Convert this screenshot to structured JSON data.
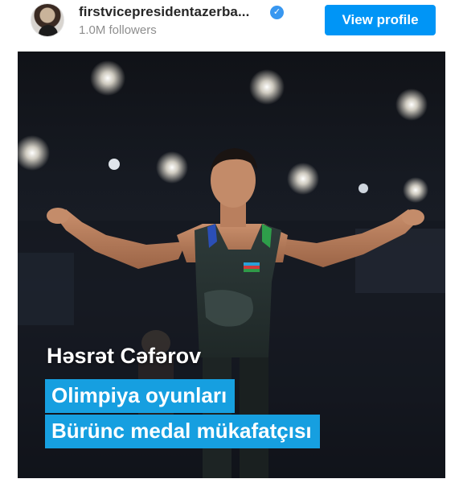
{
  "header": {
    "username": "firstvicepresidentazerba...",
    "verified_icon": "verified-badge-icon",
    "followers": "1.0M followers",
    "view_profile_label": "View profile"
  },
  "post": {
    "name": "Həsrət Cəfərov",
    "line1": "Olimpiya oyunları",
    "line2": "Bürünc medal mükafatçısı",
    "band_color": "#169fe0"
  }
}
